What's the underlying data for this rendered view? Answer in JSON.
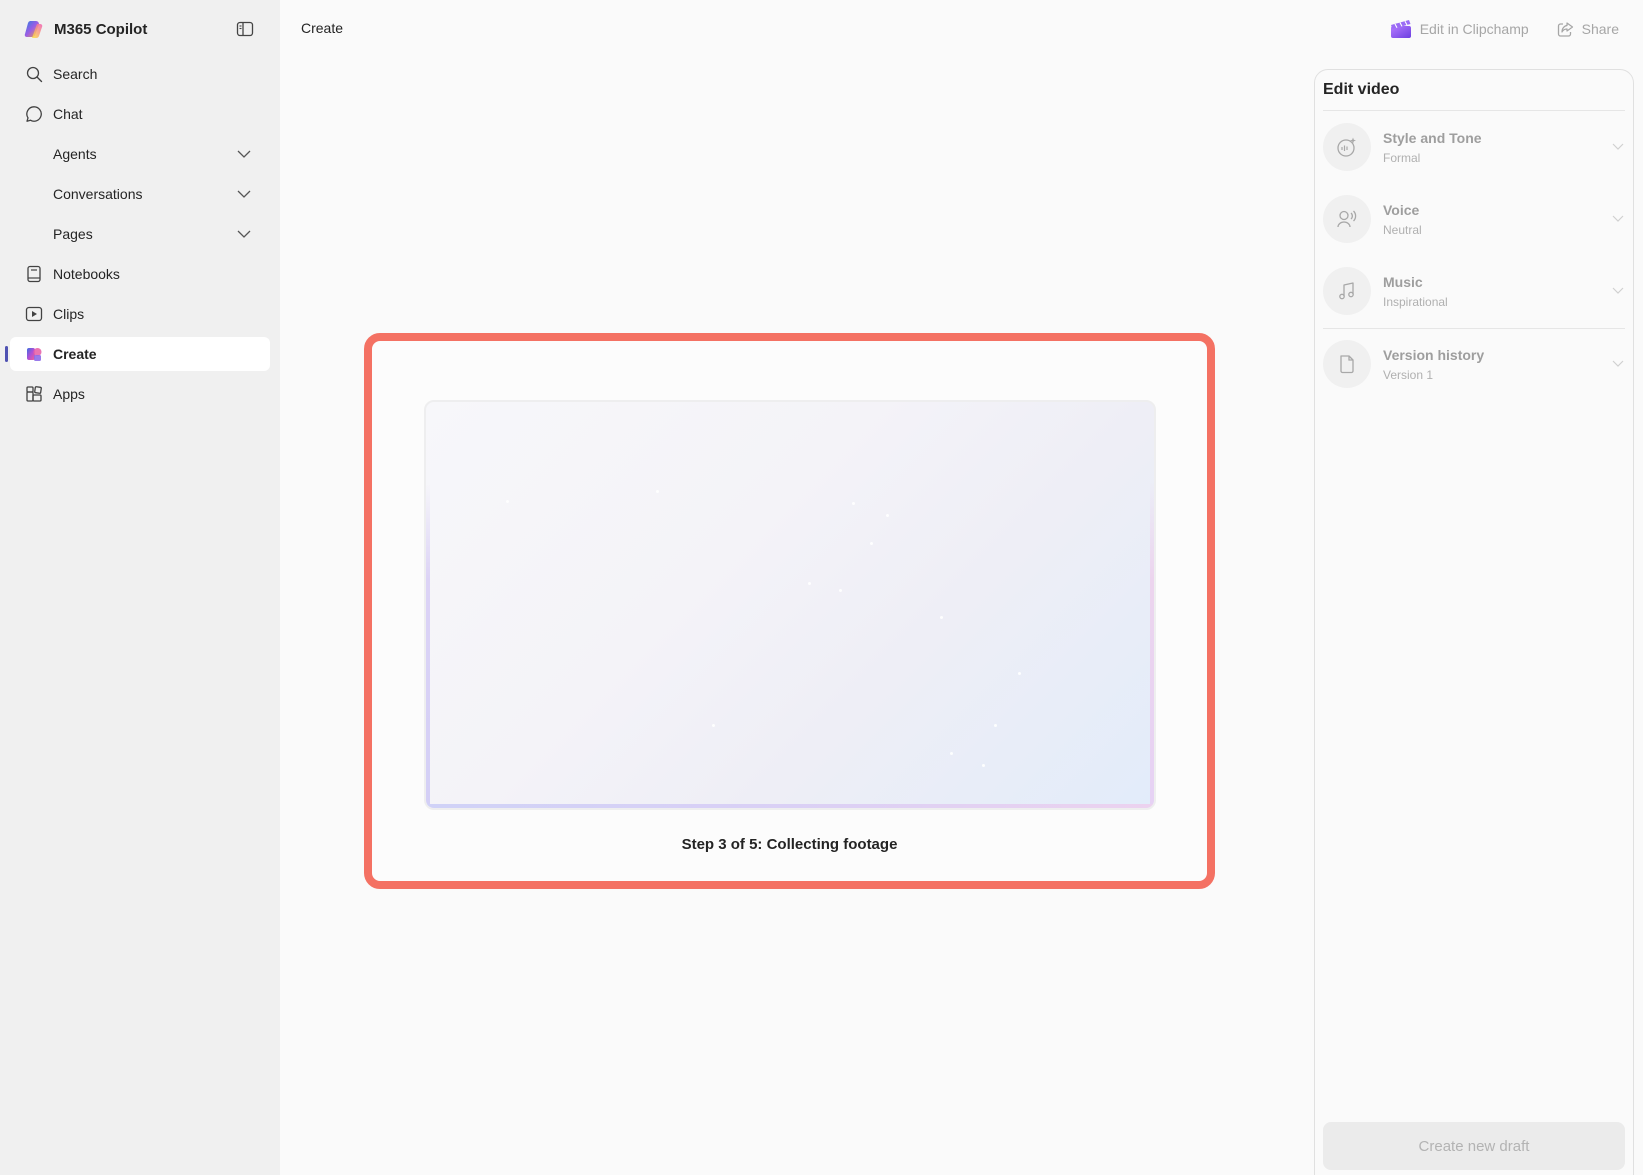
{
  "app": {
    "title": "M365 Copilot",
    "logo_icon": "copilot-logo-icon",
    "collapse_icon": "sidebar-toggle-icon"
  },
  "sidebar": {
    "items": [
      {
        "label": "Search",
        "icon": "search-icon"
      },
      {
        "label": "Chat",
        "icon": "chat-icon"
      },
      {
        "label": "Agents",
        "expandable": true
      },
      {
        "label": "Conversations",
        "expandable": true
      },
      {
        "label": "Pages",
        "expandable": true
      },
      {
        "label": "Notebooks",
        "icon": "notebook-icon"
      },
      {
        "label": "Clips",
        "icon": "clips-icon"
      },
      {
        "label": "Create",
        "icon": "create-icon",
        "active": true
      },
      {
        "label": "Apps",
        "icon": "apps-icon"
      }
    ]
  },
  "header": {
    "title": "Create",
    "edit_clipchamp_label": "Edit in Clipchamp",
    "share_label": "Share"
  },
  "progress": {
    "step_text": "Step 3 of 5: Collecting footage",
    "accent_color": "#f47163"
  },
  "edit_panel": {
    "title": "Edit video",
    "options": [
      {
        "name": "Style and Tone",
        "value": "Formal",
        "icon": "style-tone-icon"
      },
      {
        "name": "Voice",
        "value": "Neutral",
        "icon": "voice-icon"
      },
      {
        "name": "Music",
        "value": "Inspirational",
        "icon": "music-icon"
      },
      {
        "name": "Version history",
        "value": "Version 1",
        "icon": "document-icon"
      }
    ],
    "create_draft_label": "Create new draft"
  }
}
